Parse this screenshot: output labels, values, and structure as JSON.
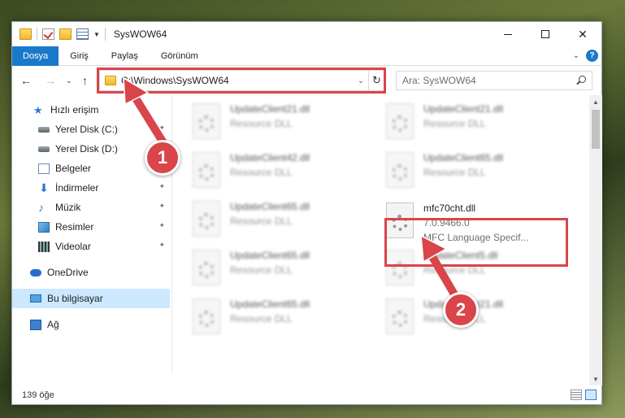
{
  "window": {
    "title": "SysWOW64",
    "minimize_symbol": "",
    "maximize_symbol": "",
    "close_symbol": "✕"
  },
  "ribbon": {
    "tabs": [
      "Dosya",
      "Giriş",
      "Paylaş",
      "Görünüm"
    ],
    "expand_symbol": "⌄",
    "help_symbol": "?"
  },
  "nav": {
    "back": "←",
    "forward": "→",
    "recent": "⌄",
    "up": "↑"
  },
  "address": {
    "path": "C:\\Windows\\SysWOW64",
    "dropdown_symbol": "⌄",
    "refresh_symbol": "↻"
  },
  "search": {
    "placeholder": "Ara: SysWOW64"
  },
  "sidebar": {
    "items": [
      {
        "label": "Hızlı erişim",
        "icon": "star-icon",
        "pinned": false
      },
      {
        "label": "Yerel Disk (C:)",
        "icon": "disk-icon",
        "pinned": true
      },
      {
        "label": "Yerel Disk (D:)",
        "icon": "disk-icon",
        "pinned": false
      },
      {
        "label": "Belgeler",
        "icon": "documents-icon",
        "pinned": false
      },
      {
        "label": "İndirmeler",
        "icon": "download-icon",
        "pinned": true
      },
      {
        "label": "Müzik",
        "icon": "music-icon",
        "pinned": true
      },
      {
        "label": "Resimler",
        "icon": "pictures-icon",
        "pinned": true
      },
      {
        "label": "Videolar",
        "icon": "video-icon",
        "pinned": true
      },
      {
        "label": "OneDrive",
        "icon": "onedrive-icon",
        "pinned": false
      },
      {
        "label": "Bu bilgisayar",
        "icon": "computer-icon",
        "pinned": false
      },
      {
        "label": "Ağ",
        "icon": "network-icon",
        "pinned": false
      }
    ],
    "pin_symbol": "📌"
  },
  "files": [
    {
      "name": "UpdateClient21.dll",
      "line2": "Resource DLL",
      "line3": "",
      "blurred": true
    },
    {
      "name": "UpdateClient21.dll",
      "line2": "Resource DLL",
      "line3": "",
      "blurred": true
    },
    {
      "name": "UpdateClient42.dll",
      "line2": "Resource DLL",
      "line3": "",
      "blurred": true
    },
    {
      "name": "UpdateClient65.dll",
      "line2": "Resource DLL",
      "line3": "",
      "blurred": true
    },
    {
      "name": "UpdateClient65.dll",
      "line2": "Resource DLL",
      "line3": "",
      "blurred": true
    },
    {
      "name": "mfc70cht.dll",
      "line2": "7.0.9466.0",
      "line3": "MFC Language Specif...",
      "blurred": false
    },
    {
      "name": "UpdateClient65.dll",
      "line2": "Resource DLL",
      "line3": "",
      "blurred": true
    },
    {
      "name": "UpdateClient5.dll",
      "line2": "Resource DLL",
      "line3": "",
      "blurred": true
    },
    {
      "name": "UpdateClient65.dll",
      "line2": "Resource DLL",
      "line3": "",
      "blurred": true
    },
    {
      "name": "UpdateClient21.dll",
      "line2": "Resource DLL",
      "line3": "",
      "blurred": true
    }
  ],
  "scrollbar": {
    "up": "▲",
    "down": "▼"
  },
  "status": {
    "item_count": "139 öğe"
  },
  "annotations": {
    "step1": "1",
    "step2": "2",
    "color": "#d9454a"
  }
}
